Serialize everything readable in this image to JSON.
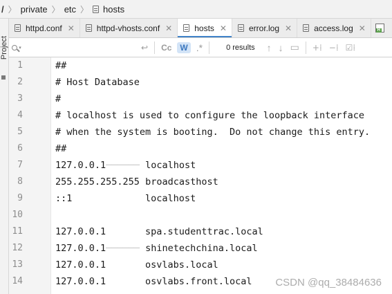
{
  "breadcrumb": {
    "root": "/",
    "items": [
      "private",
      "etc",
      "hosts"
    ]
  },
  "toolstrip": {
    "label": "Project"
  },
  "tabs": [
    {
      "label": "httpd.conf",
      "close": "✕",
      "active": false
    },
    {
      "label": "httpd-vhosts.conf",
      "close": "✕",
      "active": false
    },
    {
      "label": "hosts",
      "close": "✕",
      "active": true
    },
    {
      "label": "error.log",
      "close": "✕",
      "active": false
    },
    {
      "label": "access.log",
      "close": "✕",
      "active": false
    }
  ],
  "tab_edge_icon_letter": "H",
  "search": {
    "value": "",
    "placeholder": "",
    "case_label": "Cc",
    "words_label": "W",
    "regex_label": ".*",
    "results": "0 results"
  },
  "editor": {
    "lines": [
      {
        "num": "1",
        "code": "##"
      },
      {
        "num": "2",
        "code": "# Host Database"
      },
      {
        "num": "3",
        "code": "#"
      },
      {
        "num": "4",
        "code": "# localhost is used to configure the loopback interface"
      },
      {
        "num": "5",
        "code": "# when the system is booting.  Do not change this entry."
      },
      {
        "num": "6",
        "code": "##"
      },
      {
        "num": "7",
        "code": "127.0.0.1\tlocalhost"
      },
      {
        "num": "8",
        "code": "255.255.255.255\tbroadcasthost"
      },
      {
        "num": "9",
        "code": "::1             localhost"
      },
      {
        "num": "10",
        "code": ""
      },
      {
        "num": "11",
        "code": "127.0.0.1       spa.studenttrac.local"
      },
      {
        "num": "12",
        "code": "127.0.0.1\tshinetechchina.local"
      },
      {
        "num": "13",
        "code": "127.0.0.1       osvlabs.local"
      },
      {
        "num": "14",
        "code": "127.0.0.1       osvlabs.front.local"
      }
    ]
  },
  "watermark": "CSDN @qq_38484636",
  "colors": {
    "accent": "#4083c9",
    "words_toggle_bg": "#d3e4f7"
  }
}
